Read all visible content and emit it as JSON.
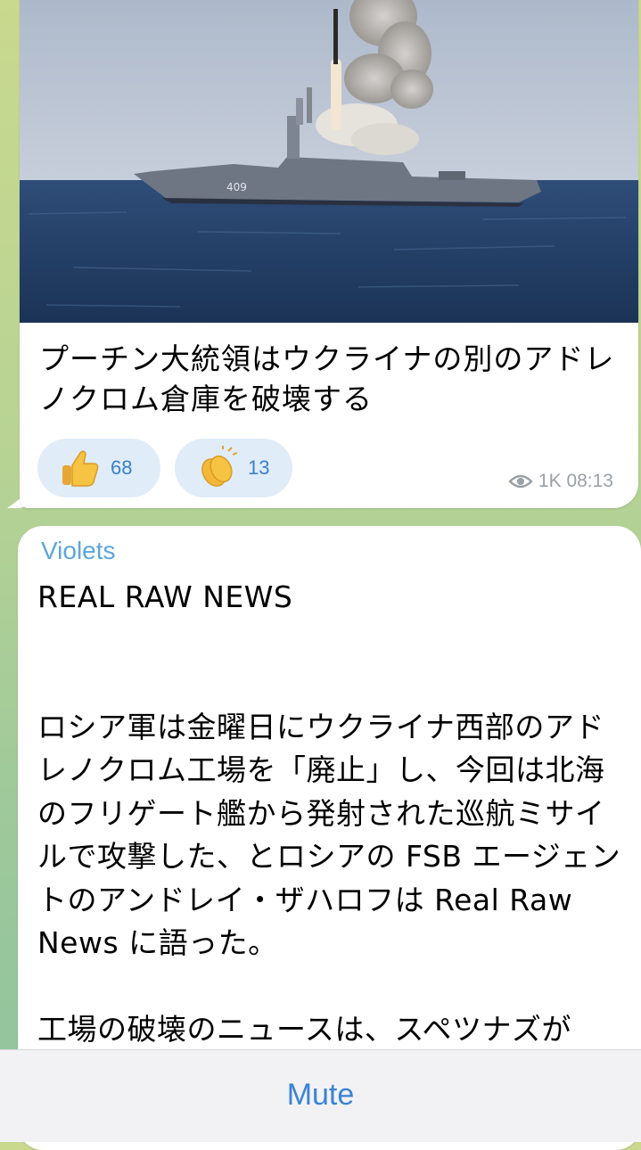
{
  "post1": {
    "text": "プーチン大統領はウクライナの別のアドレノクロム倉庫を破壊する",
    "reactions": [
      {
        "emoji": "thumbs-up",
        "count": "68"
      },
      {
        "emoji": "clapping-hands",
        "count": "13"
      }
    ],
    "views": "1K",
    "time": "08:13"
  },
  "post2": {
    "sender": "Violets",
    "text": "REAL RAW NEWS\n\n\nロシア軍は金曜日にウクライナ西部のアドレノクロム工場を「廃止」し、今回は北海のフリゲート艦から発射された巡航ミサイルで攻撃した、とロシアの FSB エージェントのアンドレイ・ザハロフは Real Raw News に語った。\n\n工場の破壊のニュースは、スペツナズが"
  },
  "bottom_bar": {
    "mute_label": "Mute"
  }
}
